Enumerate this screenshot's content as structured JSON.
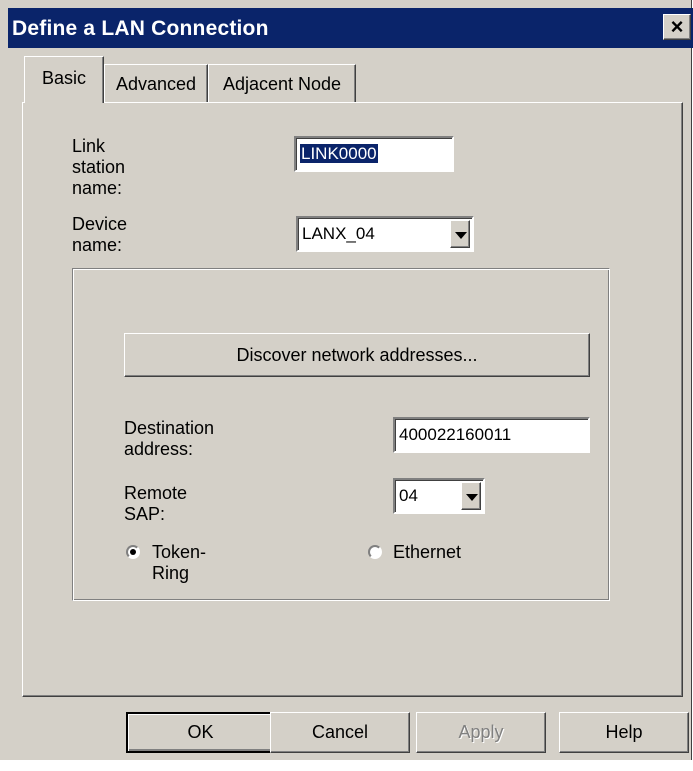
{
  "window": {
    "title": "Define a LAN Connection",
    "close_glyph": "✕"
  },
  "tabs": [
    {
      "label": "Basic",
      "active": true
    },
    {
      "label": "Advanced",
      "active": false
    },
    {
      "label": "Adjacent Node",
      "active": false
    }
  ],
  "basic": {
    "link_station_label": "Link station name:",
    "link_station_value": "LINK0000",
    "device_label": "Device name:",
    "device_value": "LANX_04",
    "discover_button": "Discover network addresses...",
    "destination_label": "Destination address:",
    "destination_value": "400022160011",
    "remote_sap_label": "Remote SAP:",
    "remote_sap_value": "04",
    "radio_token_ring": "Token-Ring",
    "radio_ethernet": "Ethernet",
    "selected_network": "Token-Ring"
  },
  "buttons": {
    "ok": "OK",
    "cancel": "Cancel",
    "apply": "Apply",
    "help": "Help"
  }
}
